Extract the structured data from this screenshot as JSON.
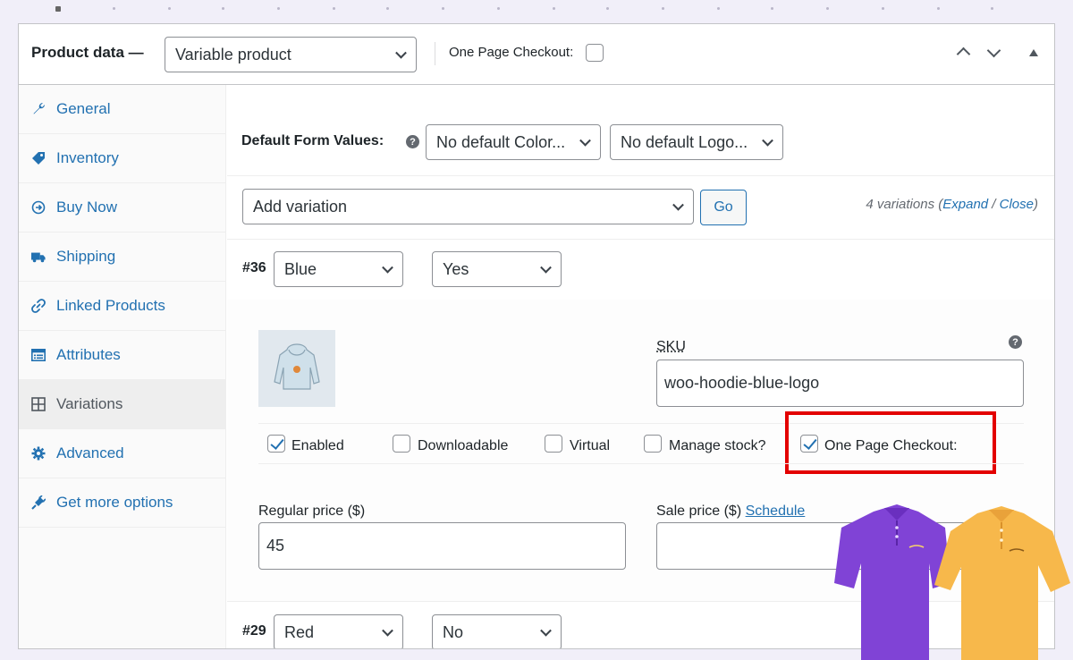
{
  "header": {
    "title": "Product data —",
    "product_type": "Variable product",
    "one_page_checkout_label": "One Page Checkout:"
  },
  "sidebar": {
    "items": [
      {
        "label": "General",
        "icon": "wrench-icon"
      },
      {
        "label": "Inventory",
        "icon": "tag-icon"
      },
      {
        "label": "Buy Now",
        "icon": "arrow-circle-icon"
      },
      {
        "label": "Shipping",
        "icon": "truck-icon"
      },
      {
        "label": "Linked Products",
        "icon": "link-icon"
      },
      {
        "label": "Attributes",
        "icon": "list-icon"
      },
      {
        "label": "Variations",
        "icon": "grid-icon"
      },
      {
        "label": "Advanced",
        "icon": "gear-icon"
      },
      {
        "label": "Get more options",
        "icon": "plugin-icon"
      }
    ]
  },
  "defaults": {
    "label": "Default Form Values:",
    "color_select": "No default Color...",
    "logo_select": "No default Logo..."
  },
  "add_variation": {
    "select": "Add variation",
    "go": "Go",
    "count_text": "4 variations",
    "expand": "Expand",
    "separator": "/",
    "close": "Close"
  },
  "variations": [
    {
      "number": "#36",
      "color": "Blue",
      "logo": "Yes"
    },
    {
      "number": "#29",
      "color": "Red",
      "logo": "No"
    }
  ],
  "expanded": {
    "sku_label": "SKU",
    "sku_value": "woo-hoodie-blue-logo",
    "checkboxes": [
      {
        "label": "Enabled",
        "checked": true
      },
      {
        "label": "Downloadable",
        "checked": false
      },
      {
        "label": "Virtual",
        "checked": false
      },
      {
        "label": "Manage stock?",
        "checked": false
      },
      {
        "label": "One Page Checkout:",
        "checked": true
      }
    ],
    "regular_price_label": "Regular price ($)",
    "regular_price_value": "45",
    "sale_price_label": "Sale price ($)",
    "schedule_link": "Schedule"
  },
  "colors": {
    "accent": "#2271b1",
    "highlight": "#e30000",
    "shirt_purple": "#8043d6",
    "shirt_yellow": "#f7b84b"
  }
}
